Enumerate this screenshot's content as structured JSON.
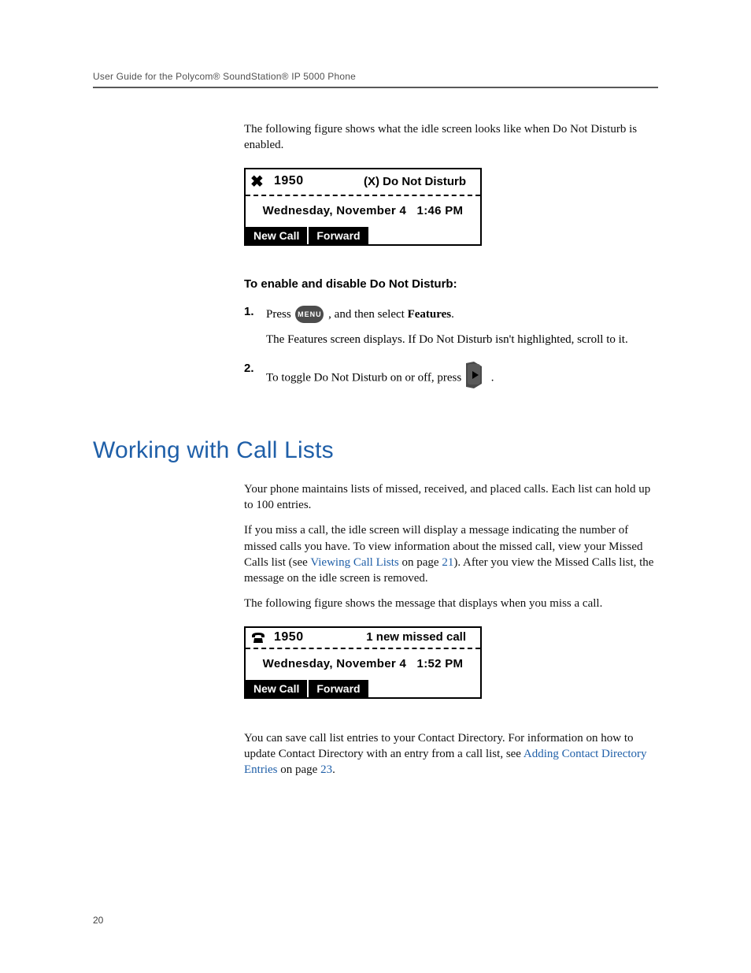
{
  "header": {
    "running_head": "User Guide for the Polycom® SoundStation® IP 5000 Phone"
  },
  "dnd_section": {
    "intro": "The following figure shows what the idle screen looks like when Do Not Disturb is enabled.",
    "screen": {
      "icon": "x",
      "extension": "1950",
      "status": "(X) Do Not Disturb",
      "date": "Wednesday, November 4",
      "time": "1:46 PM",
      "softkeys": [
        "New Call",
        "Forward"
      ]
    },
    "subhead": "To enable and disable Do Not Disturb:",
    "step1_num": "1.",
    "step1_press": "Press ",
    "step1_rest_a": " , and then select ",
    "step1_features": "Features",
    "step1_rest_b": ".",
    "menu_label": "MENU",
    "step1_sub": "The Features screen displays. If Do Not Disturb isn't highlighted, scroll to it.",
    "step2_num": "2.",
    "step2_a": "To toggle Do Not Disturb on or off, press ",
    "step2_b": " ."
  },
  "call_lists": {
    "heading": "Working with Call Lists",
    "p1": "Your phone maintains lists of missed, received, and placed calls. Each list can hold up to 100 entries.",
    "p2_a": "If you miss a call, the idle screen will display a message indicating the number of missed calls you have. To view information about the missed call, view your Missed Calls list (see ",
    "p2_link1": "Viewing Call Lists",
    "p2_b": " on page ",
    "p2_link2": "21",
    "p2_c": "). After you view the Missed Calls list, the message on the idle screen is removed.",
    "p3": "The following figure shows the message that displays when you miss a call.",
    "screen": {
      "icon": "phone",
      "extension": "1950",
      "status": "1 new missed call",
      "date": "Wednesday, November 4",
      "time": "1:52 PM",
      "softkeys": [
        "New Call",
        "Forward"
      ]
    },
    "p4_a": "You can save call list entries to your Contact Directory. For information on how to update Contact Directory with an entry from a call list, see ",
    "p4_link1": "Adding Contact Directory Entries",
    "p4_b": " on page ",
    "p4_link2": "23",
    "p4_c": "."
  },
  "page_number": "20"
}
